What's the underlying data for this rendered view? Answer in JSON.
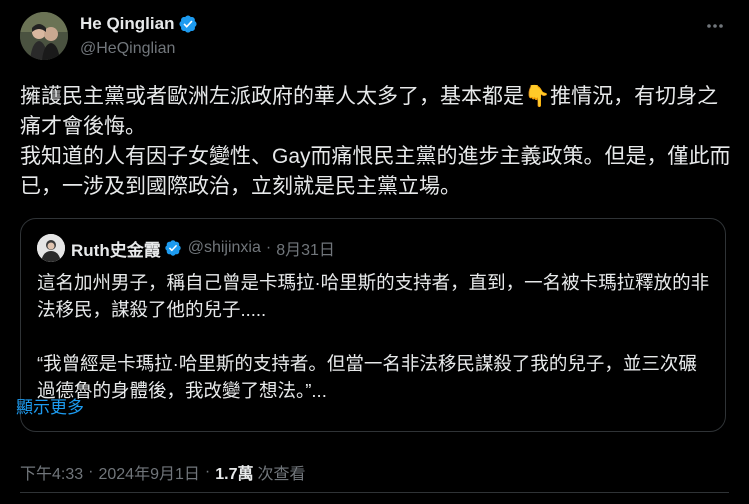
{
  "author": {
    "display_name": "He Qinglian",
    "handle": "@HeQinglian"
  },
  "tweet": {
    "lines": [
      "擁護民主黨或者歐洲左派政府的華人太多了，基本都是👇推情況，有切身之痛才會後悔。",
      "我知道的人有因子女變性、Gay而痛恨民主黨的進步主義政策。但是，僅此而已，一涉及到國際政治，立刻就是民主黨立場。"
    ]
  },
  "quoted": {
    "display_name": "Ruth史金霞",
    "handle": "@shijinxia",
    "separator": "·",
    "date": "8月31日",
    "paragraph1": "這名加州男子，稱自己曾是卡瑪拉·哈里斯的支持者，直到，一名被卡瑪拉釋放的非法移民，謀殺了他的兒子.....",
    "paragraph2": "“我曾經是卡瑪拉·哈里斯的支持者。但當一名非法移民謀殺了我的兒子，並三次碾過德魯的身體後，我改變了想法。”...",
    "show_more": "顯示更多"
  },
  "meta": {
    "time": "下午4:33",
    "separator": "·",
    "date": "2024年9月1日",
    "views_count": "1.7萬",
    "views_label": "次查看"
  },
  "icons": {
    "verified": "verified-badge-icon",
    "more": "more-horizontal-icon"
  },
  "colors": {
    "background": "#000000",
    "text": "#e7e9ea",
    "secondary": "#71767b",
    "link": "#1d9bf0",
    "border": "#2f3336",
    "verified": "#1d9bf0"
  }
}
